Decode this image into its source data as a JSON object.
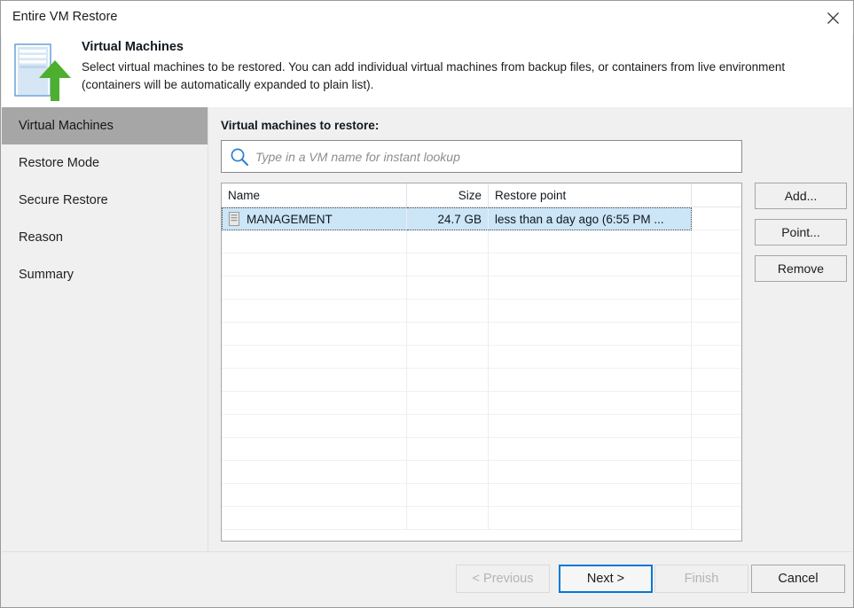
{
  "window": {
    "title": "Entire VM Restore",
    "close_icon": "close-icon"
  },
  "header": {
    "icon": "vm-restore-upload-icon",
    "title": "Virtual Machines",
    "description": "Select virtual machines to be restored. You  can add individual virtual machines from backup files, or containers from live environment (containers will be automatically expanded to plain list)."
  },
  "sidebar": {
    "items": [
      {
        "label": "Virtual Machines",
        "active": true
      },
      {
        "label": "Restore Mode",
        "active": false
      },
      {
        "label": "Secure Restore",
        "active": false
      },
      {
        "label": "Reason",
        "active": false
      },
      {
        "label": "Summary",
        "active": false
      }
    ]
  },
  "main": {
    "list_label": "Virtual machines to restore:",
    "search": {
      "icon": "search-icon",
      "placeholder": "Type in a VM name for instant lookup",
      "value": ""
    },
    "table": {
      "columns": [
        "Name",
        "Size",
        "Restore point",
        ""
      ],
      "rows": [
        {
          "icon": "vm-icon",
          "name": "MANAGEMENT",
          "size": "24.7 GB",
          "restore_point": "less than a day ago (6:55 PM ...",
          "selected": true
        }
      ],
      "empty_row_count": 13
    },
    "side_buttons": [
      {
        "label": "Add...",
        "enabled": true
      },
      {
        "label": "Point...",
        "enabled": true
      },
      {
        "label": "Remove",
        "enabled": true
      }
    ]
  },
  "footer": {
    "previous": {
      "label": "< Previous",
      "enabled": false
    },
    "next": {
      "label": "Next >",
      "enabled": true,
      "focused": true
    },
    "finish": {
      "label": "Finish",
      "enabled": false
    },
    "cancel": {
      "label": "Cancel",
      "enabled": true
    }
  },
  "colors": {
    "dialog_bg": "#f0f0f0",
    "selection_blue": "#cce5f7",
    "focus_blue": "#0078d7",
    "sidebar_active": "#a6a6a6",
    "icon_green": "#4caf2e",
    "icon_blue": "#b8d6ee"
  }
}
